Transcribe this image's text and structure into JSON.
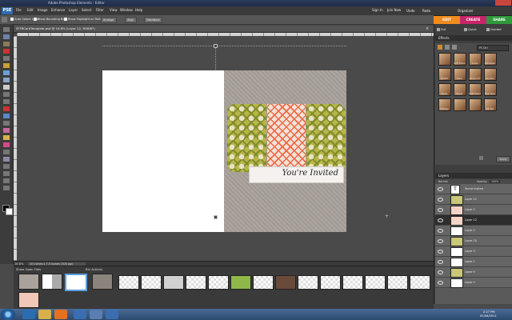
{
  "window": {
    "title": "Adobe Photoshop Elements - Editor"
  },
  "menubar": {
    "items": [
      "File",
      "Edit",
      "Image",
      "Enhance",
      "Layer",
      "Select",
      "Filter",
      "View",
      "Window",
      "Help"
    ],
    "sign_in": "Sign In",
    "join_now": "Join Now",
    "undo": "Undo",
    "redo": "Redo",
    "organizer": "Organizer"
  },
  "mode_tabs": {
    "edit": "EDIT",
    "create": "CREATE",
    "share": "SHARE"
  },
  "options": {
    "auto_select": "Auto Select Layer",
    "bounding_box": "Show Bounding Box",
    "highlight": "Show Highlight on Rollover",
    "arrange": "Arrange",
    "align": "Align",
    "distribute": "Distribute"
  },
  "edit_modes": {
    "full": "Full",
    "quick": "Quick",
    "guided": "Guided"
  },
  "document": {
    "tab_name": "SFFRCardTemplate.psd @ 16.8% (Layer 12, RGB/8*)",
    "zoom": "16.8%",
    "info": "10 inches x 7.5 inches (300 ppi)",
    "banner_text": "You're Invited"
  },
  "effects_panel": {
    "title": "Effects",
    "filter": "PS Ctrl",
    "apply_label": "Apply",
    "thumbs": [
      "",
      "Soft Focus",
      "Cross",
      "Old Paper",
      "Sketch",
      "Dark",
      "Photo Cnt",
      "Lavnder",
      "Sepia",
      "Paper",
      "Soft Faded",
      "Blur Tone",
      "Vintage",
      "",
      "",
      "PS Old"
    ]
  },
  "layers_panel": {
    "title": "Layers",
    "blend_mode": "Normal",
    "opacity_label": "Opacity:",
    "opacity_value": "100%",
    "layers": [
      {
        "name": "You're Invited",
        "type": "text",
        "selected": false
      },
      {
        "name": "Layer 11",
        "type": "green",
        "selected": false
      },
      {
        "name": "Layer 2",
        "type": "pink",
        "selected": false
      },
      {
        "name": "Layer 12",
        "type": "pink",
        "selected": true
      },
      {
        "name": "Layer 2",
        "type": "white",
        "selected": false
      },
      {
        "name": "Layer 10",
        "type": "green",
        "selected": false
      },
      {
        "name": "Layer 3",
        "type": "white",
        "selected": false
      },
      {
        "name": "Layer 1",
        "type": "white",
        "selected": false
      },
      {
        "name": "Layer 9",
        "type": "green",
        "selected": false
      },
      {
        "name": "Layer 0",
        "type": "white",
        "selected": false
      }
    ]
  },
  "bin": {
    "photo_bin": "Show Open Files",
    "bin_actions": "Bin Actions"
  },
  "taskbar": {
    "time": "2:27 PM",
    "date": "02/08/2011"
  },
  "colors": {
    "accent_edit": "#f08c1e",
    "accent_create": "#c8246a",
    "accent_share": "#2f9a3c"
  }
}
